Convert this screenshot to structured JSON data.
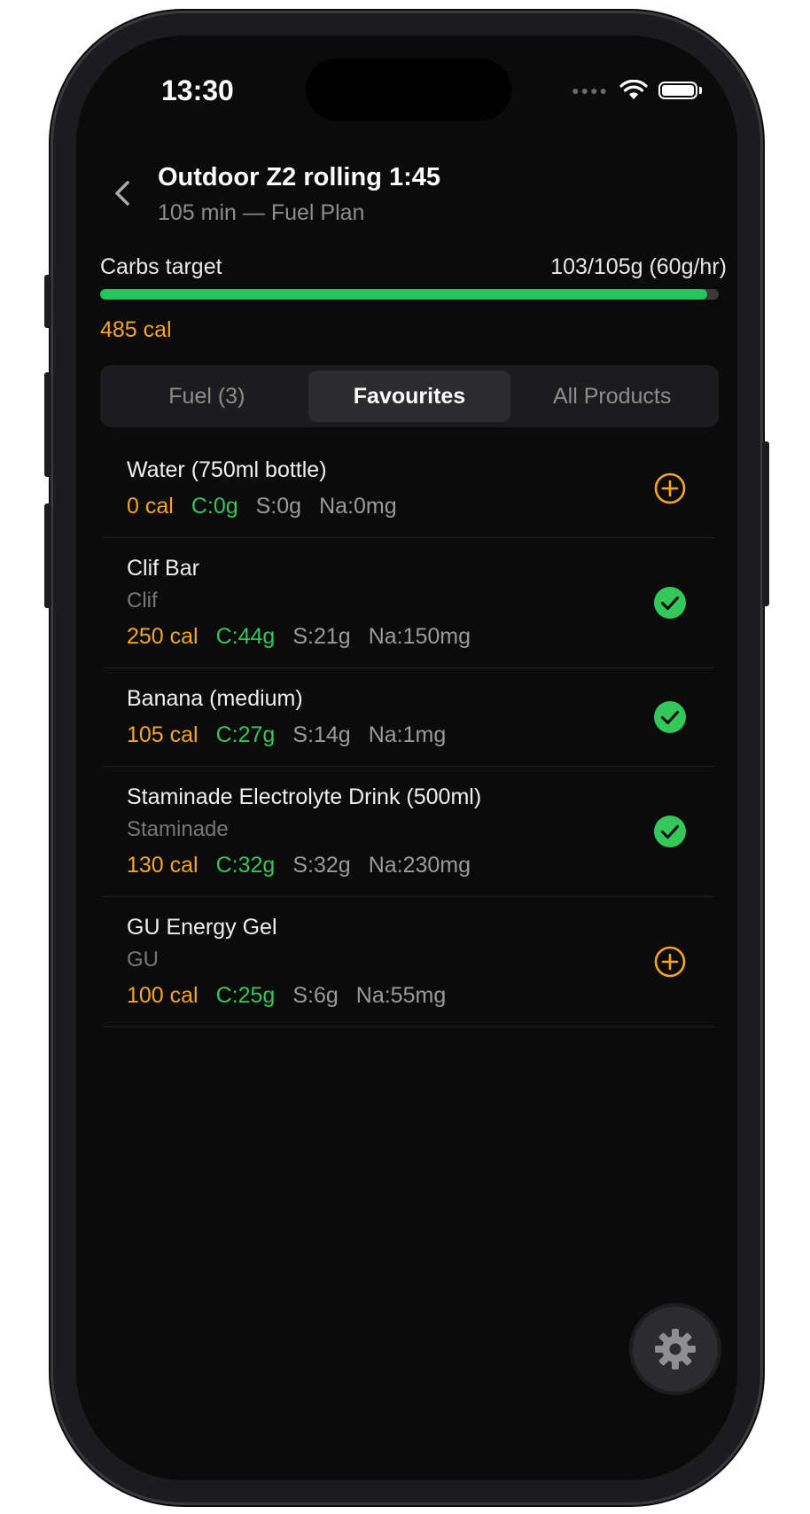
{
  "status_bar": {
    "time": "13:30",
    "wifi_icon": "wifi-icon",
    "battery_icon": "battery-icon"
  },
  "header": {
    "back_icon": "chevron-left-icon",
    "title": "Outdoor Z2 rolling 1:45",
    "subtitle": "105 min — Fuel Plan"
  },
  "carbs": {
    "label": "Carbs target",
    "value": "103/105g (60g/hr)",
    "progress_fraction": 0.981,
    "calories": "485 cal"
  },
  "tabs": [
    {
      "label": "Fuel (3)",
      "active": false
    },
    {
      "label": "Favourites",
      "active": true
    },
    {
      "label": "All Products",
      "active": false
    }
  ],
  "items": [
    {
      "name": "Water (750ml bottle)",
      "brand": "",
      "cal": "0 cal",
      "carbs": "C:0g",
      "sugar": "S:0g",
      "sodium": "Na:0mg",
      "state": "add"
    },
    {
      "name": "Clif Bar",
      "brand": "Clif",
      "cal": "250 cal",
      "carbs": "C:44g",
      "sugar": "S:21g",
      "sodium": "Na:150mg",
      "state": "added"
    },
    {
      "name": "Banana (medium)",
      "brand": "",
      "cal": "105 cal",
      "carbs": "C:27g",
      "sugar": "S:14g",
      "sodium": "Na:1mg",
      "state": "added"
    },
    {
      "name": "Staminade Electrolyte Drink (500ml)",
      "brand": "Staminade",
      "cal": "130 cal",
      "carbs": "C:32g",
      "sugar": "S:32g",
      "sodium": "Na:230mg",
      "state": "added"
    },
    {
      "name": "GU Energy Gel",
      "brand": "GU",
      "cal": "100 cal",
      "carbs": "C:25g",
      "sugar": "S:6g",
      "sodium": "Na:55mg",
      "state": "add"
    }
  ],
  "fab": {
    "icon": "gear-icon"
  },
  "colors": {
    "accent_orange": "#f5a623",
    "accent_green": "#34c759",
    "progress_green": "#22c55e",
    "background": "#0b0b0b"
  }
}
